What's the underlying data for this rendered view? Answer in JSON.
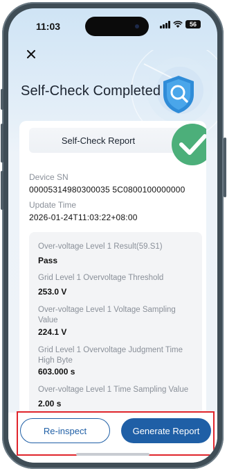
{
  "status_bar": {
    "time": "11:03",
    "battery": "56"
  },
  "header": {
    "close_icon": "close-icon",
    "title": "Self-Check Completed",
    "badge_icon": "shield-search-icon"
  },
  "report": {
    "title": "Self-Check Report",
    "status_icon": "check-icon",
    "device_sn_label": "Device SN",
    "device_sn": "00005314980300035 5C0800100000000",
    "update_time_label": "Update Time",
    "update_time": "2026-01-24T11:03:22+08:00",
    "results": [
      {
        "label": "Over-voltage Level 1 Result(59.S1)",
        "value": "Pass"
      },
      {
        "label": "Grid Level 1 Overvoltage Threshold",
        "value": "253.0 V"
      },
      {
        "label": "Over-voltage Level 1 Voltage Sampling Value",
        "value": "224.1 V"
      },
      {
        "label": "Grid Level 1 Overvoltage Judgment Time High Byte",
        "value": "603.000 s"
      },
      {
        "label": "Over-voltage Level 1 Time Sampling Value",
        "value": "2.00 s"
      }
    ]
  },
  "actions": {
    "reinspect_label": "Re-inspect",
    "generate_label": "Generate Report"
  },
  "colors": {
    "accent": "#1f5fa6",
    "success": "#4caf7a",
    "highlight": "#e0242b"
  }
}
